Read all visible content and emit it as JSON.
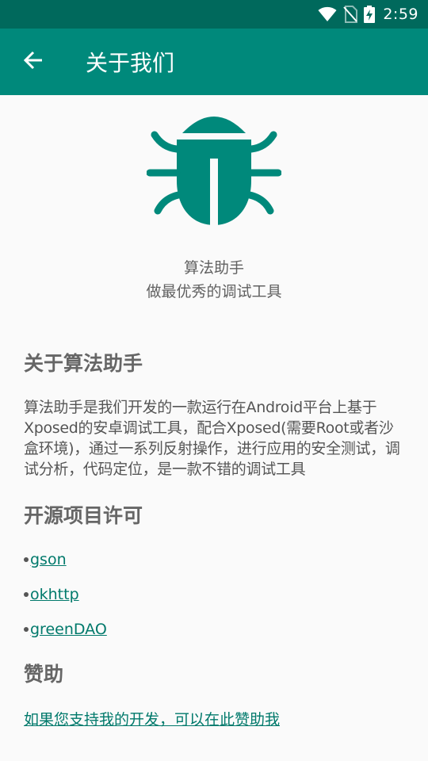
{
  "status_bar": {
    "time": "2:59",
    "icons": [
      "wifi-icon",
      "no-sim-icon",
      "battery-charging-icon"
    ]
  },
  "app_bar": {
    "back_icon": "arrow-left-icon",
    "title": "关于我们"
  },
  "header": {
    "logo_icon": "bug-icon",
    "app_name": "算法助手",
    "tagline": "做最优秀的调试工具"
  },
  "about": {
    "title": "关于算法助手",
    "description": "算法助手是我们开发的一款运行在Android平台上基于Xposed的安卓调试工具，配合Xposed(需要Root或者沙盒环境)，通过一系列反射操作，进行应用的安全测试，调试分析，代码定位，是一款不错的调试工具"
  },
  "licenses": {
    "title": "开源项目许可",
    "items": [
      {
        "label": "gson"
      },
      {
        "label": "okhttp"
      },
      {
        "label": "greenDAO"
      }
    ]
  },
  "sponsor": {
    "title": "赞助",
    "link": "如果您支持我的开发，可以在此赞助我"
  },
  "colors": {
    "status_bar": "#00695c",
    "app_bar": "#00897b",
    "logo": "#00897b",
    "link": "#00796b"
  }
}
